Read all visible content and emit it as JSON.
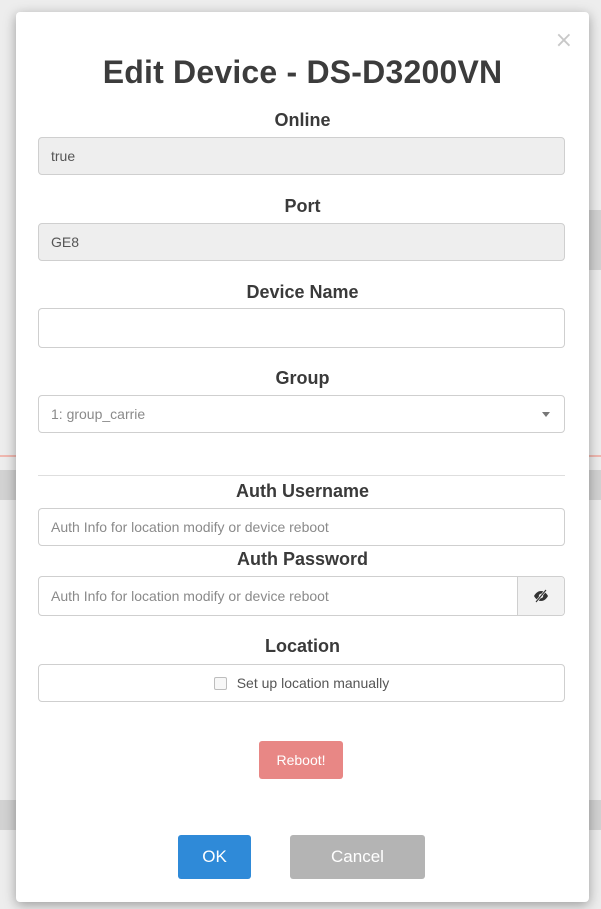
{
  "dialog": {
    "title": "Edit Device - DS-D3200VN",
    "close_glyph": "×"
  },
  "fields": {
    "online": {
      "label": "Online",
      "value": "true"
    },
    "port": {
      "label": "Port",
      "value": "GE8"
    },
    "device_name": {
      "label": "Device Name",
      "value": ""
    },
    "group": {
      "label": "Group",
      "selected": "1: group_carrie"
    },
    "auth_username": {
      "label": "Auth Username",
      "placeholder": "Auth Info for location modify or device reboot"
    },
    "auth_password": {
      "label": "Auth Password",
      "placeholder": "Auth Info for location modify or device reboot",
      "toggle_icon": "eye-slash-icon"
    },
    "location": {
      "label": "Location",
      "checkbox_label": "Set up location manually",
      "checked": false
    }
  },
  "buttons": {
    "reboot": "Reboot!",
    "ok": "OK",
    "cancel": "Cancel"
  },
  "colors": {
    "primary": "#2f8ad8",
    "danger_disabled": "#e88785",
    "cancel_disabled": "#b4b4b4"
  }
}
